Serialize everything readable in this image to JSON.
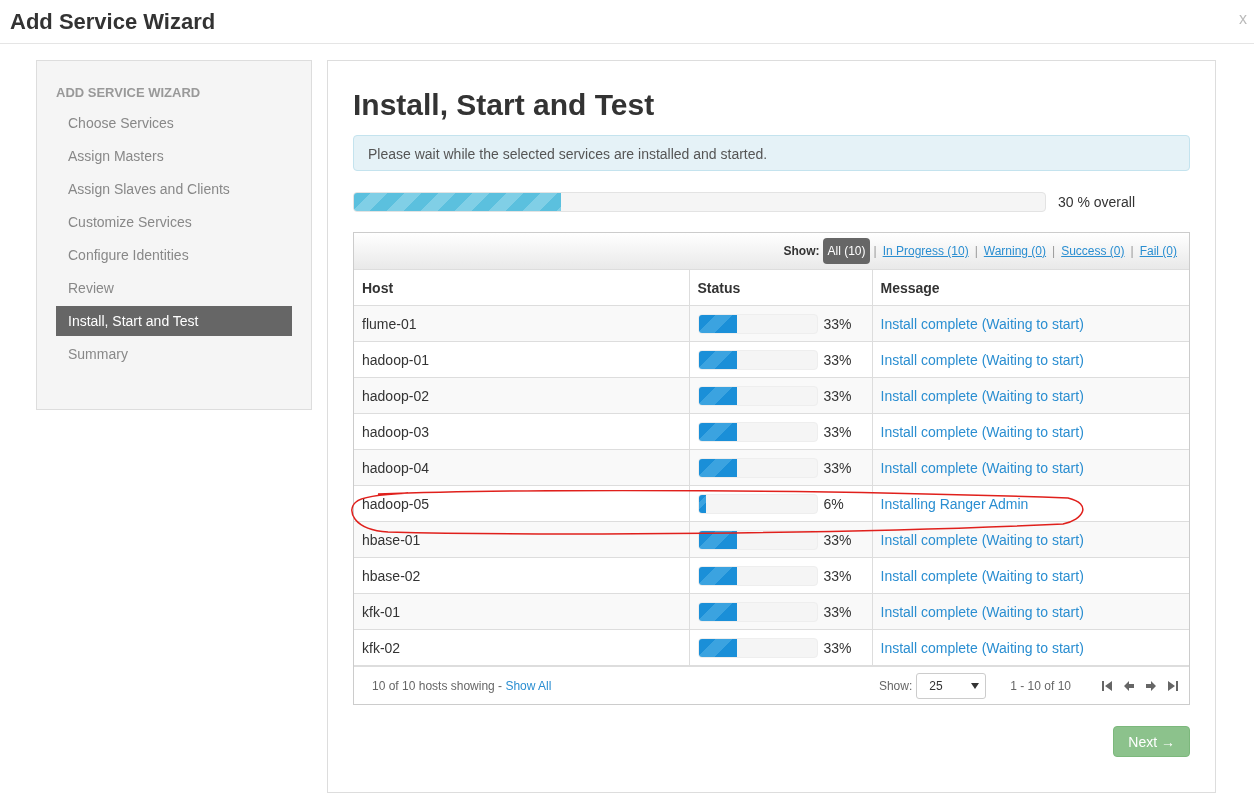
{
  "window": {
    "title": "Add Service Wizard",
    "close": "x"
  },
  "sidebar": {
    "heading": "ADD SERVICE WIZARD",
    "items": [
      {
        "label": "Choose Services",
        "selected": false
      },
      {
        "label": "Assign Masters",
        "selected": false
      },
      {
        "label": "Assign Slaves and Clients",
        "selected": false
      },
      {
        "label": "Customize Services",
        "selected": false
      },
      {
        "label": "Configure Identities",
        "selected": false
      },
      {
        "label": "Review",
        "selected": false
      },
      {
        "label": "Install, Start and Test",
        "selected": true
      },
      {
        "label": "Summary",
        "selected": false
      }
    ]
  },
  "main": {
    "title": "Install, Start and Test",
    "alert": "Please wait while the selected services are installed and started.",
    "overall_progress": {
      "level": 0.3,
      "reading": "30 % overall"
    },
    "filter": {
      "label": "Show:",
      "separator": "|",
      "options": [
        {
          "label": "All (10)",
          "selected": true
        },
        {
          "label": "In Progress (10)",
          "selected": false
        },
        {
          "label": "Warning (0)",
          "selected": false
        },
        {
          "label": "Success (0)",
          "selected": false
        },
        {
          "label": "Fail (0)",
          "selected": false
        }
      ]
    },
    "table": {
      "columns": [
        "Host",
        "Status",
        "Message"
      ],
      "rows": [
        {
          "host": "flume-01",
          "level": 0.33,
          "percent": "33%",
          "message": "Install complete (Waiting to start)",
          "circled": false
        },
        {
          "host": "hadoop-01",
          "level": 0.33,
          "percent": "33%",
          "message": "Install complete (Waiting to start)",
          "circled": false
        },
        {
          "host": "hadoop-02",
          "level": 0.33,
          "percent": "33%",
          "message": "Install complete (Waiting to start)",
          "circled": false
        },
        {
          "host": "hadoop-03",
          "level": 0.33,
          "percent": "33%",
          "message": "Install complete (Waiting to start)",
          "circled": false
        },
        {
          "host": "hadoop-04",
          "level": 0.33,
          "percent": "33%",
          "message": "Install complete (Waiting to start)",
          "circled": false
        },
        {
          "host": "hadoop-05",
          "level": 0.06,
          "percent": "6%",
          "message": "Installing Ranger Admin",
          "circled": true
        },
        {
          "host": "hbase-01",
          "level": 0.33,
          "percent": "33%",
          "message": "Install complete (Waiting to start)",
          "circled": false
        },
        {
          "host": "hbase-02",
          "level": 0.33,
          "percent": "33%",
          "message": "Install complete (Waiting to start)",
          "circled": false
        },
        {
          "host": "kfk-01",
          "level": 0.33,
          "percent": "33%",
          "message": "Install complete (Waiting to start)",
          "circled": false
        },
        {
          "host": "kfk-02",
          "level": 0.33,
          "percent": "33%",
          "message": "Install complete (Waiting to start)",
          "circled": false
        }
      ],
      "footer": {
        "summary": "10 of 10 hosts showing - ",
        "show_all": "Show All",
        "page_size_label": "Show:",
        "page_size": "25",
        "range": "1 - 10 of 10"
      }
    },
    "next_button": "Next →"
  }
}
